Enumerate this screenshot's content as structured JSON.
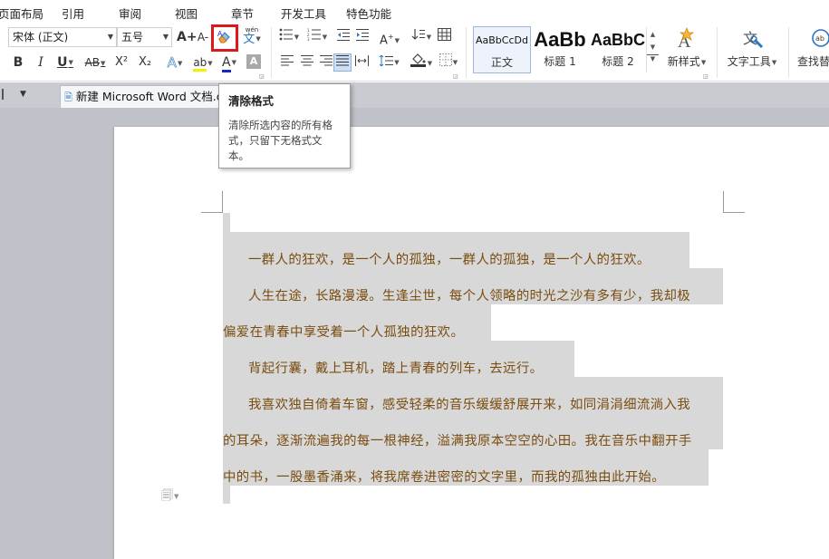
{
  "menubar": {
    "items": [
      "页面布局",
      "引用",
      "审阅",
      "视图",
      "章节",
      "开发工具",
      "特色功能"
    ]
  },
  "ribbon": {
    "font_name": "宋体 (正文)",
    "font_size": "五号",
    "grow_font": "A+",
    "shrink_font": "A-",
    "phonetic_top": "wén",
    "phonetic_bottom": "文",
    "bold": "B",
    "italic": "I",
    "underline": "U",
    "strike": "AB",
    "superscript": "X²",
    "subscript": "X₂",
    "text_effect": "A",
    "highlight_label": "ab",
    "font_color_label": "A",
    "char_shading": "A",
    "styles": [
      {
        "sample": "AaBbCcDd",
        "name": "正文"
      },
      {
        "sample": "AaBb",
        "name": "标题 1"
      },
      {
        "sample": "AaBbC",
        "name": "标题 2"
      }
    ],
    "new_style_label": "新样式",
    "text_tools_label": "文字工具",
    "find_replace_label": "查找替",
    "font_color_hex": "#1a24c8",
    "highlight_color_hex": "#f2f200",
    "accent_red": "#e0161b"
  },
  "tabstrip": {
    "doc_tab_label": "新建 Microsoft Word 文档.d"
  },
  "document": {
    "lines": [
      "一群人的狂欢，是一个人的孤独，一群人的孤独，是一个人的狂欢。",
      "人生在途，长路漫漫。生逢尘世，每个人领略的时光之沙有多有少，我却极",
      "偏爱在青春中享受着一个人孤独的狂欢。",
      "背起行囊，戴上耳机，踏上青春的列车，去远行。",
      "我喜欢独自倚着车窗，感受轻柔的音乐缓缓舒展开来，如同涓涓细流淌入我",
      "的耳朵，逐渐流遍我的每一根神经，溢满我原本空空的心田。我在音乐中翻开手",
      "中的书，一股墨香涌来，将我席卷进密密的文字里，而我的孤独由此开始。"
    ]
  },
  "tooltip": {
    "title": "清除格式",
    "body": "清除所选内容的所有格式，只留下无格式文本。"
  }
}
